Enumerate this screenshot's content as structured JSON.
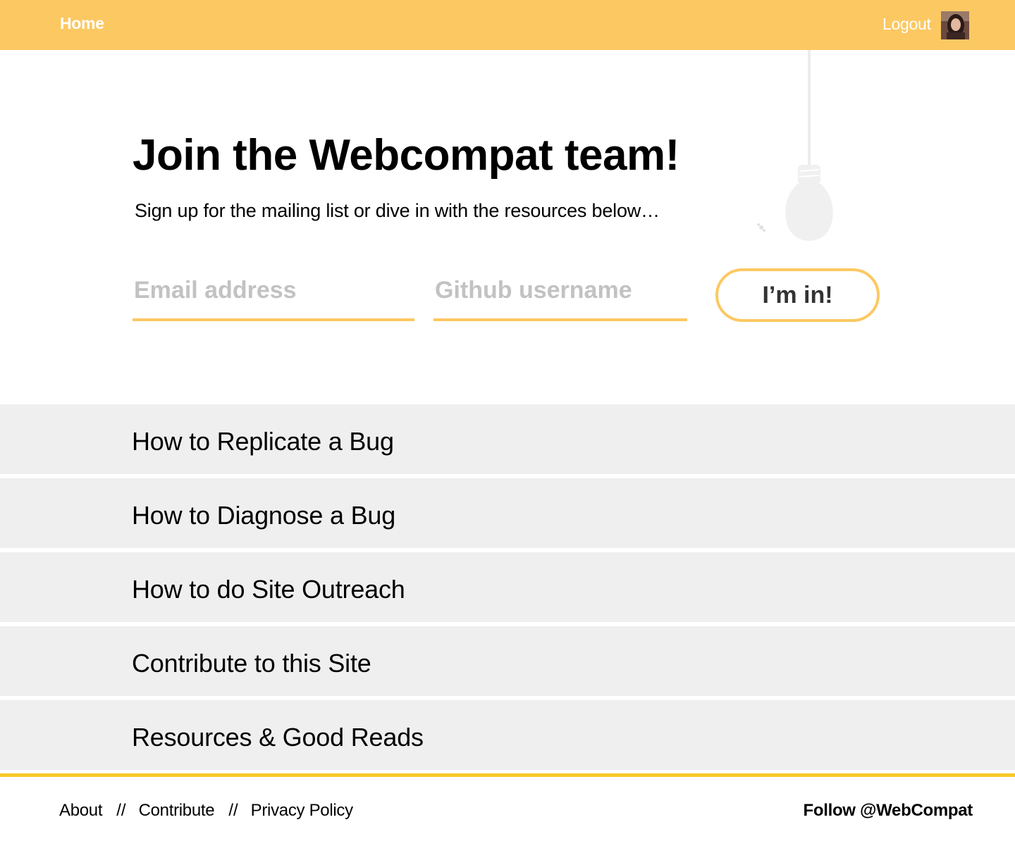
{
  "nav": {
    "home_label": "Home",
    "logout_label": "Logout"
  },
  "hero": {
    "title": "Join the Webcompat team!",
    "subtitle": "Sign up for the mailing list or dive in with the resources below…"
  },
  "form": {
    "email_placeholder": "Email address",
    "github_placeholder": "Github username",
    "submit_label": "I’m in!"
  },
  "resources": [
    {
      "label": "How to Replicate a Bug"
    },
    {
      "label": "How to Diagnose a Bug"
    },
    {
      "label": "How to do Site Outreach"
    },
    {
      "label": "Contribute to this Site"
    },
    {
      "label": "Resources & Good Reads"
    }
  ],
  "footer": {
    "links": [
      {
        "label": "About"
      },
      {
        "label": "Contribute"
      },
      {
        "label": "Privacy Policy"
      }
    ],
    "separator": "//",
    "follow_label": "Follow @WebCompat"
  },
  "colors": {
    "brand": "#fcc862",
    "footer_accent": "#f7c928",
    "list_bg": "#efefef",
    "placeholder": "#c2c2c2"
  },
  "icons": {
    "decoration": "lightbulb-icon",
    "user": "avatar"
  }
}
